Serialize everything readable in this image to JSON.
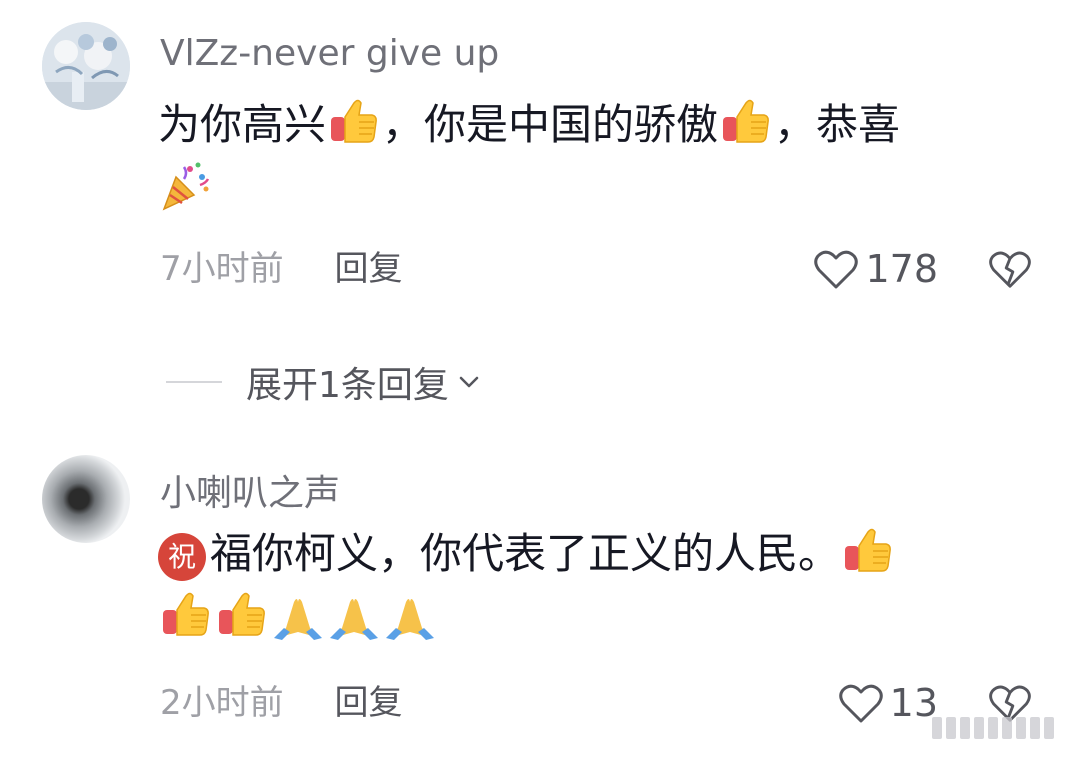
{
  "comments": [
    {
      "username": "VlZz-never give up",
      "content": {
        "part1": "为你高兴",
        "part2": "，你是中国的骄傲",
        "part3": "，恭喜"
      },
      "emojis": [
        "thumbs-up-emoji",
        "thumbs-up-emoji",
        "party-popper-emoji"
      ],
      "time": "7小时前",
      "reply_label": "回复",
      "likes": "178"
    },
    {
      "username": "小喇叭之声",
      "content": {
        "badge": "祝",
        "text": "福你柯义，你代表了正义的人民。"
      },
      "emojis": [
        "thumbs-up-emoji",
        "thumbs-up-emoji",
        "thumbs-up-emoji",
        "folded-hands-emoji",
        "folded-hands-emoji",
        "folded-hands-emoji"
      ],
      "time": "2小时前",
      "reply_label": "回复",
      "likes": "13"
    }
  ],
  "expand_replies": "展开1条回复",
  "icons": {
    "like": "heart-outline-icon",
    "dislike": "broken-heart-icon",
    "expand": "chevron-down-icon"
  },
  "colors": {
    "text": "#161823",
    "username": "#6f7078",
    "secondary": "#9fa0a6",
    "badge": "#d6453a"
  }
}
